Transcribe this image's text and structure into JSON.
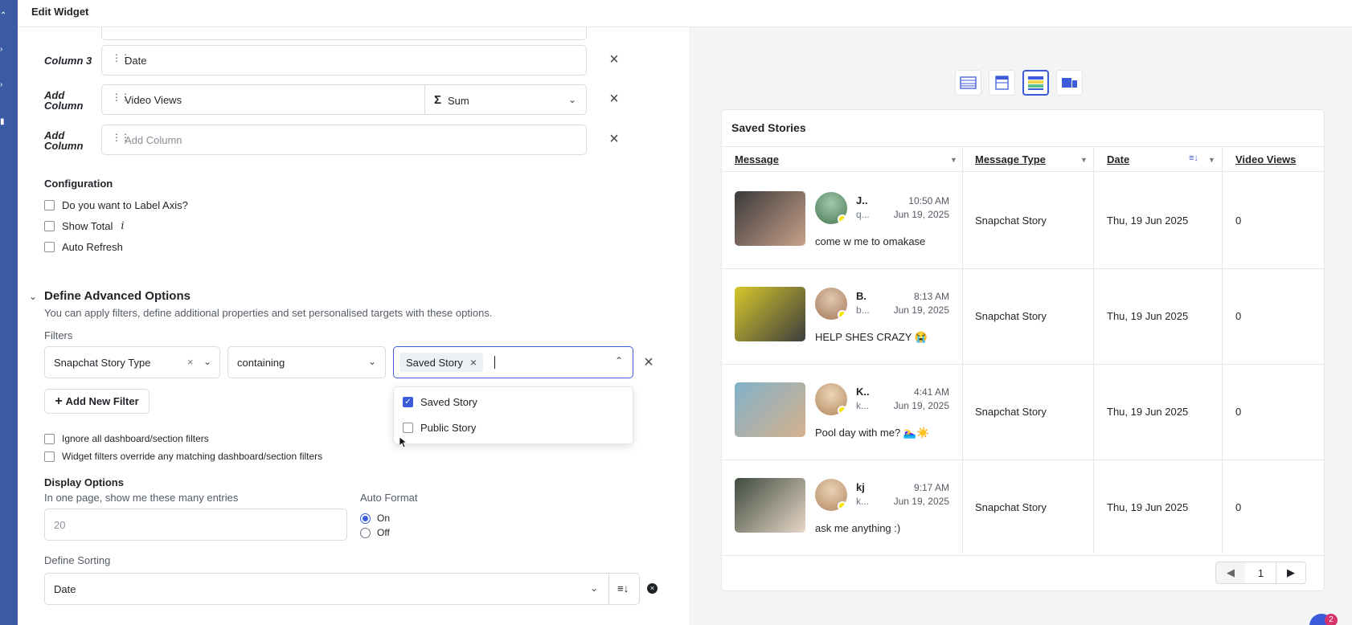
{
  "header": {
    "title": "Edit Widget"
  },
  "columns": {
    "rows": [
      {
        "label": "Column 3",
        "value": "Date"
      },
      {
        "label": "Add Column",
        "value": "Video Views",
        "aggregation": "Sum"
      },
      {
        "label": "Add Column",
        "placeholder": "Add Column"
      }
    ],
    "sigma": "Σ"
  },
  "configuration": {
    "title": "Configuration",
    "options": [
      {
        "label": "Do you want to Label Axis?",
        "checked": false
      },
      {
        "label": "Show Total",
        "info": "i",
        "checked": false
      },
      {
        "label": "Auto Refresh",
        "checked": false
      }
    ]
  },
  "advanced": {
    "title": "Define Advanced Options",
    "description": "You can apply filters, define additional properties and set personalised targets with these options.",
    "filters_label": "Filters",
    "filter": {
      "field": "Snapchat Story Type",
      "operator": "containing",
      "selected_chip": "Saved Story"
    },
    "dropdown": [
      {
        "label": "Saved Story",
        "checked": true
      },
      {
        "label": "Public Story",
        "checked": false
      }
    ],
    "add_filter_label": "Add New Filter",
    "add_filter_plus": "+",
    "filter_options": [
      {
        "label": "Ignore all dashboard/section filters",
        "checked": false
      },
      {
        "label": "Widget filters override any matching dashboard/section filters",
        "checked": false
      }
    ]
  },
  "display": {
    "title": "Display Options",
    "entries_label": "In one page, show me these many entries",
    "entries_placeholder": "20",
    "auto_format_label": "Auto Format",
    "auto_format_options": [
      {
        "label": "On",
        "selected": true
      },
      {
        "label": "Off",
        "selected": false
      }
    ]
  },
  "sorting": {
    "label": "Define Sorting",
    "value": "Date"
  },
  "preview": {
    "title": "Saved Stories",
    "headers": [
      "Message",
      "Message Type",
      "Date",
      "Video Views"
    ],
    "rows": [
      {
        "name": "J..",
        "handle": "q...",
        "time": "10:50 AM",
        "date": "Jun 19, 2025",
        "message": "come w me to omakase",
        "type": "Snapchat Story",
        "date_col": "Thu, 19 Jun 2025",
        "views": "0",
        "thumb_colors": [
          "#3a3a3a",
          "#c9a08a"
        ],
        "avatar_colors": [
          "#9fc7a8",
          "#4a7b57"
        ]
      },
      {
        "name": "B.",
        "handle": "b...",
        "time": "8:13 AM",
        "date": "Jun 19, 2025",
        "message": "HELP SHES CRAZY 😭",
        "type": "Snapchat Story",
        "date_col": "Thu, 19 Jun 2025",
        "views": "0",
        "thumb_colors": [
          "#d6c72a",
          "#3d3d3d"
        ],
        "avatar_colors": [
          "#e0c9b0",
          "#a6785a"
        ]
      },
      {
        "name": "K..",
        "handle": "k...",
        "time": "4:41 AM",
        "date": "Jun 19, 2025",
        "message": "Pool day with me? 🏊‍♀️☀️",
        "type": "Snapchat Story",
        "date_col": "Thu, 19 Jun 2025",
        "views": "0",
        "thumb_colors": [
          "#7fb2c9",
          "#d7b08d"
        ],
        "avatar_colors": [
          "#ecd6b8",
          "#b4875f"
        ]
      },
      {
        "name": "kj",
        "handle": "k...",
        "time": "9:17 AM",
        "date": "Jun 19, 2025",
        "message": "ask me anything :)",
        "type": "Snapchat Story",
        "date_col": "Thu, 19 Jun 2025",
        "views": "0",
        "thumb_colors": [
          "#3e4a3e",
          "#e8d7c7"
        ],
        "avatar_colors": [
          "#e9d2b5",
          "#b58a63"
        ]
      }
    ],
    "pager": {
      "prev": "◀",
      "page": "1",
      "next": "▶"
    }
  },
  "fab_badge": "2",
  "icons": [
    "drag-handle-icon",
    "close-icon",
    "chevron-down-icon",
    "chevron-up-icon",
    "sort-icon",
    "info-icon",
    "table-view-icon",
    "list-view-icon",
    "color-table-view-icon",
    "card-view-icon"
  ],
  "colors": {
    "accent": "#3b5bdb",
    "rail": "#3b5ba5",
    "badge": "#ffe600"
  }
}
